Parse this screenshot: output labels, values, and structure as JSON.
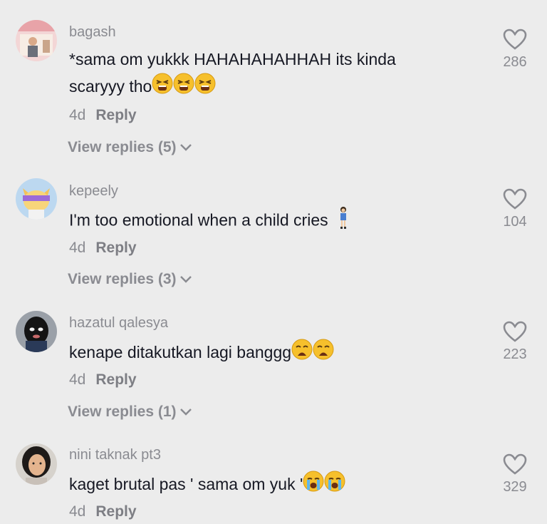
{
  "comments": [
    {
      "username": "bagash",
      "text_line1": "*sama om yukkk HAHAHAHAHHAH its kinda",
      "text_line2": "scaryyy tho",
      "emoji": [
        "tired-face",
        "tired-face",
        "tired-face"
      ],
      "time": "4d",
      "reply_label": "Reply",
      "view_replies": "View replies (5)",
      "likes": "286"
    },
    {
      "username": "kepeely",
      "text_line1": "I'm too emotional when a child cries",
      "emoji": [
        "girl-standing"
      ],
      "time": "4d",
      "reply_label": "Reply",
      "view_replies": "View replies (3)",
      "likes": "104"
    },
    {
      "username": "hazatul qalesya",
      "text_line1": "kenape ditakutkan lagi banggg",
      "emoji": [
        "weary-face",
        "weary-face"
      ],
      "time": "4d",
      "reply_label": "Reply",
      "view_replies": "View replies (1)",
      "likes": "223"
    },
    {
      "username": "nini taknak pt3",
      "text_line1": "kaget brutal pas ' sama om yuk '",
      "emoji": [
        "crying-face",
        "crying-face"
      ],
      "time": "4d",
      "reply_label": "Reply",
      "likes": "329"
    }
  ],
  "colors": {
    "background": "#ececec",
    "text": "#161823",
    "secondary": "#8a8b91",
    "emoji_yellow": "#f6c02c"
  }
}
